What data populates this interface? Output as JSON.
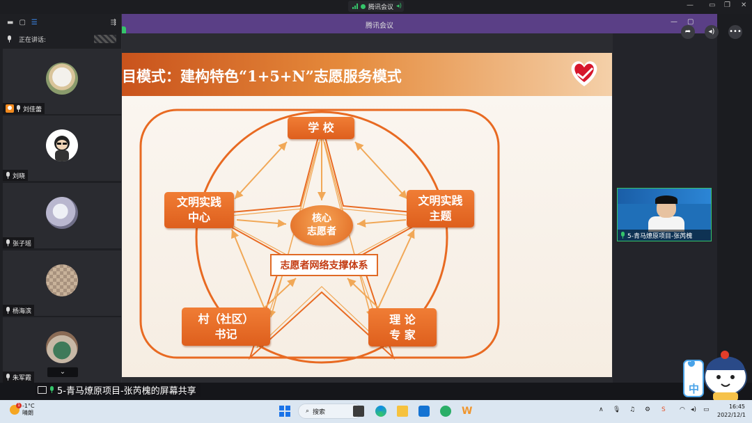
{
  "window": {
    "app_title": "腾讯会议",
    "meeting_bar_title": "腾讯会议"
  },
  "left_panel": {
    "speaking_label": "正在讲话:",
    "participants": [
      {
        "name": "刘佳蕾",
        "is_host": true
      },
      {
        "name": "刘晓",
        "is_host": false
      },
      {
        "name": "张子瑶",
        "is_host": false
      },
      {
        "name": "杨海滨",
        "is_host": false
      },
      {
        "name": "朱军霞",
        "is_host": false
      }
    ],
    "scroll_down_glyph": "⌄"
  },
  "slide": {
    "title": "目模式：建构特色“1+5+N”志愿服务模式",
    "nodes": {
      "school": "学 校",
      "center_l1": "文明实践",
      "center_l2": "中心",
      "theme_l1": "文明实践",
      "theme_l2": "主题",
      "village_l1": "村（社区）",
      "village_l2": "书记",
      "expert_l1": "理 论",
      "expert_l2": "专 家",
      "core_l1": "核心",
      "core_l2": "志愿者",
      "network": "志愿者网络支撑体系"
    }
  },
  "share_bar": {
    "label": "5-青马燎原项目-张芮槐的屏幕共享"
  },
  "video_preview": {
    "caption": "5-青马燎原项目-张芮槐"
  },
  "mascot": {
    "ime_label": "中"
  },
  "taskbar": {
    "weather_temp": "-1°C",
    "weather_desc": "晴朗",
    "weather_badge": "1",
    "search_label": "搜索",
    "tray_ime": "中",
    "time": "16:45",
    "date": "2022/12/1"
  },
  "colors": {
    "accent_orange": "#e0651f",
    "meeting_purple": "#5a3f86",
    "active_green": "#35c46a"
  }
}
